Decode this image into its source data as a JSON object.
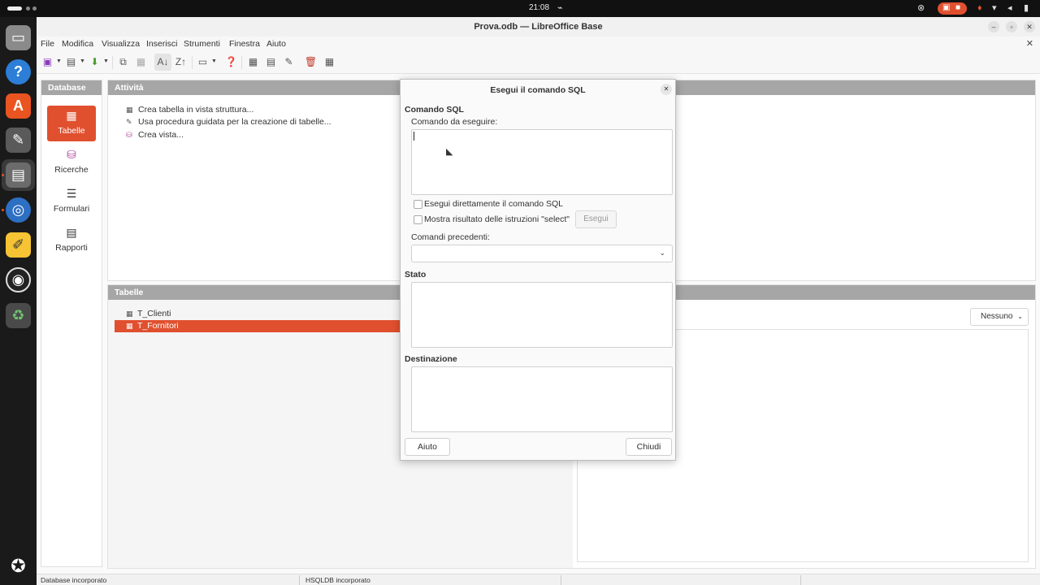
{
  "system": {
    "clock": "21:08",
    "accent_color": "#e0502f",
    "dock_apps": [
      "files-icon",
      "help-icon",
      "app-center-icon",
      "gimp-icon",
      "libreoffice-icon",
      "chromium-icon",
      "text-editor-icon",
      "obs-icon",
      "trash-icon",
      "ubuntu-icon"
    ]
  },
  "window": {
    "title": "Prova.odb — LibreOffice Base"
  },
  "menu": {
    "items": [
      "File",
      "Modifica",
      "Visualizza",
      "Inserisci",
      "Strumenti",
      "Finestra",
      "Aiuto"
    ]
  },
  "database": {
    "header": "Database",
    "items": [
      {
        "label": "Tabelle",
        "icon": "table-icon",
        "active": true
      },
      {
        "label": "Ricerche",
        "icon": "query-icon",
        "active": false
      },
      {
        "label": "Formulari",
        "icon": "form-icon",
        "active": false
      },
      {
        "label": "Rapporti",
        "icon": "report-icon",
        "active": false
      }
    ]
  },
  "tasks": {
    "header": "Attività",
    "items": [
      {
        "label": "Crea tabella in vista struttura...",
        "icon": "table-design-icon"
      },
      {
        "label": "Usa procedura guidata per la creazione di tabelle...",
        "icon": "wizard-icon"
      },
      {
        "label": "Crea vista...",
        "icon": "view-icon"
      }
    ]
  },
  "tables": {
    "header": "Tabelle",
    "items": [
      {
        "label": "T_Clienti",
        "selected": false
      },
      {
        "label": "T_Fornitori",
        "selected": true
      }
    ],
    "preview_option": "Nessuno"
  },
  "statusbar": {
    "left": "Database incorporato",
    "middle": "HSQLDB incorporato"
  },
  "dialog": {
    "title": "Esegui il comando SQL",
    "section_sql": "Comando SQL",
    "command_label": "Comando da eseguire:",
    "command_value": "",
    "check_direct": "Esegui direttamente il comando SQL",
    "check_show_select": "Mostra risultato delle istruzioni \"select\"",
    "run_button": "Esegui",
    "previous_label": "Comandi precedenti:",
    "previous_value": "",
    "section_status": "Stato",
    "section_output": "Destinazione",
    "help_button": "Aiuto",
    "close_button": "Chiudi"
  }
}
